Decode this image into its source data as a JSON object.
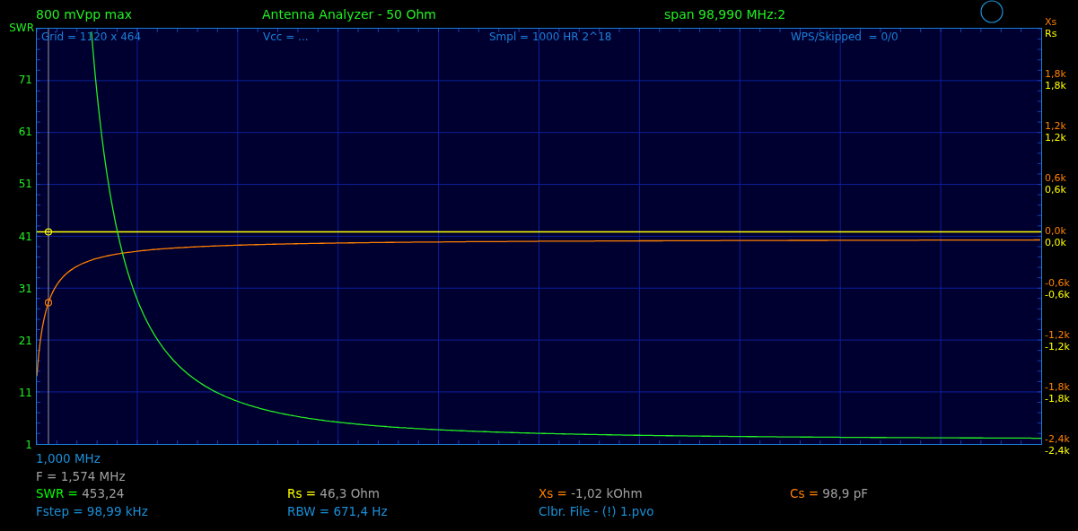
{
  "header": {
    "amplitude": "800 mVpp max",
    "title": "Antenna Analyzer - 50 Ohm",
    "span": "span 98,990 MHz:2"
  },
  "plot": {
    "info": [
      "Grid = 1120 x 464",
      "Vcc = ...",
      "Smpl = 1000 HR 2^18",
      "WPS/Skipped  = 0/0"
    ],
    "left_axis": {
      "title": "SWR",
      "ticks": [
        "71",
        "61",
        "51",
        "41",
        "31",
        "21",
        "11",
        "1"
      ]
    },
    "right_axis": {
      "titles": {
        "xs": "Xs",
        "rs": "Rs"
      },
      "ticks": [
        {
          "xs": "1,8k",
          "rs": "1,8k"
        },
        {
          "xs": "1,2k",
          "rs": "1,2k"
        },
        {
          "xs": "0,6k",
          "rs": "0,6k"
        },
        {
          "xs": "0,0k",
          "rs": "0,0k"
        },
        {
          "xs": "-0,6k",
          "rs": "-0,6k"
        },
        {
          "xs": "-1,2k",
          "rs": "-1,2k"
        },
        {
          "xs": "-1,8k",
          "rs": "-1,8k"
        },
        {
          "xs": "-2,4k",
          "rs": "-2,4k"
        }
      ]
    }
  },
  "footer": {
    "start_frequency": "1,000 MHz",
    "cursor_frequency": "F = 1,574 MHz",
    "readings": [
      {
        "label": "SWR =",
        "value": "453,24",
        "color": "#00ff00"
      },
      {
        "label": "Rs =",
        "value": "46,3 Ohm",
        "color": "#ffff00"
      },
      {
        "label": "Xs =",
        "value": "-1,02 kOhm",
        "color": "#ff8000"
      },
      {
        "label": "Cs =",
        "value": "98,9 pF",
        "color": "#ff8000"
      }
    ],
    "info": [
      "Fstep = 98,99 kHz",
      "RBW = 671,4 Hz",
      "Clbr. File - (!) 1.pvo"
    ]
  }
}
